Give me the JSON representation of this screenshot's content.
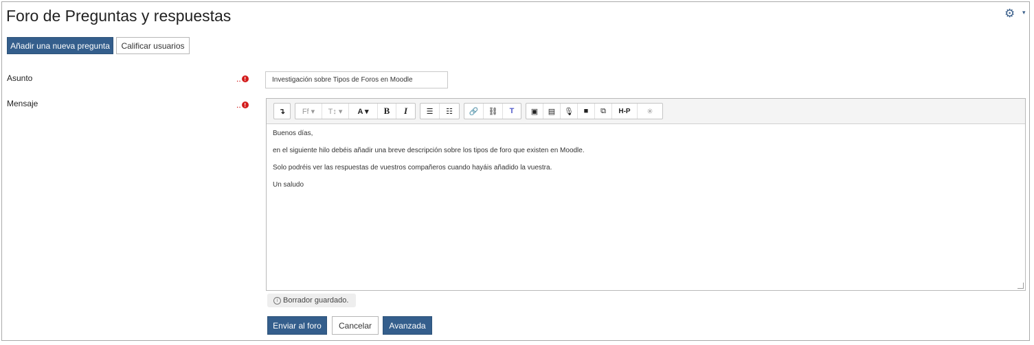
{
  "page": {
    "title": "Foro de Preguntas y respuestas"
  },
  "header_actions": {
    "gear_icon": "gear-icon",
    "caret": "▾"
  },
  "actions": {
    "new_question": "Añadir una nueva pregunta",
    "grade_users": "Calificar usuarios"
  },
  "form": {
    "subject_label": "Asunto",
    "subject_value": "Investigación sobre Tipos de Foros en Moodle",
    "message_label": "Mensaje",
    "required_marker": "!"
  },
  "toolbar": {
    "collapse": "↴",
    "font_family": "Ff ▾",
    "font_size": "T↕ ▾",
    "font_color": "A ▾",
    "bold": "B",
    "italic": "I",
    "bullet_list": "☰",
    "numbered_list": "☷",
    "link": "🔗",
    "unlink": "⛓",
    "teams": "T",
    "image": "▣",
    "media": "▤",
    "record_audio": "🎙",
    "record_video": "■",
    "manage_files": "⧉",
    "h5p": "H-P",
    "equation": "✳"
  },
  "message_body": {
    "paragraphs": [
      "Buenos días,",
      "en el siguiente hilo debéis añadir una breve descripción sobre los tipos de foro que existen en Moodle.",
      "Solo podréis ver las respuestas de vuestros compañeros cuando hayáis añadido la vuestra.",
      "Un saludo"
    ]
  },
  "draft_status": "Borrador guardado.",
  "draft_icon": "i",
  "footer": {
    "submit": "Enviar al foro",
    "cancel": "Cancelar",
    "advanced": "Avanzada"
  },
  "colors": {
    "primary": "#345e8c",
    "required": "#d31d1d"
  }
}
